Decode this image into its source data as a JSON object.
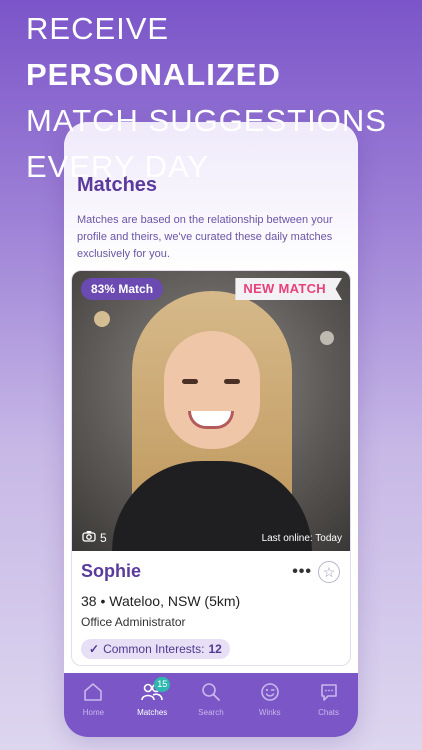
{
  "headline": {
    "line1": "RECEIVE",
    "line2": "PERSONALIZED",
    "line3": "MATCH SUGGESTIONS",
    "line4": "EVERY DAY"
  },
  "screen": {
    "title": "Matches",
    "description": "Matches are based on the relationship between your profile and theirs, we've curated these daily matches exclusively for you."
  },
  "card": {
    "match_percent": "83% Match",
    "new_label": "NEW MATCH",
    "photo_count": "5",
    "last_online": "Last online: Today",
    "name": "Sophie",
    "more_label": "•••",
    "age_location": "38 • Wateloo, NSW (5km)",
    "occupation": "Office Administrator",
    "interests_label": "Common Interests:",
    "interests_count": "12"
  },
  "tabs": [
    {
      "label": "Home",
      "icon": "home-icon",
      "active": false
    },
    {
      "label": "Matches",
      "icon": "people-icon",
      "active": true,
      "badge": "15"
    },
    {
      "label": "Search",
      "icon": "search-icon",
      "active": false
    },
    {
      "label": "Winks",
      "icon": "wink-icon",
      "active": false
    },
    {
      "label": "Chats",
      "icon": "chat-icon",
      "active": false
    }
  ],
  "colors": {
    "brand": "#7a56c6",
    "title": "#5a3b9c",
    "new_match": "#e8407c",
    "badge": "#2fb8b0"
  }
}
